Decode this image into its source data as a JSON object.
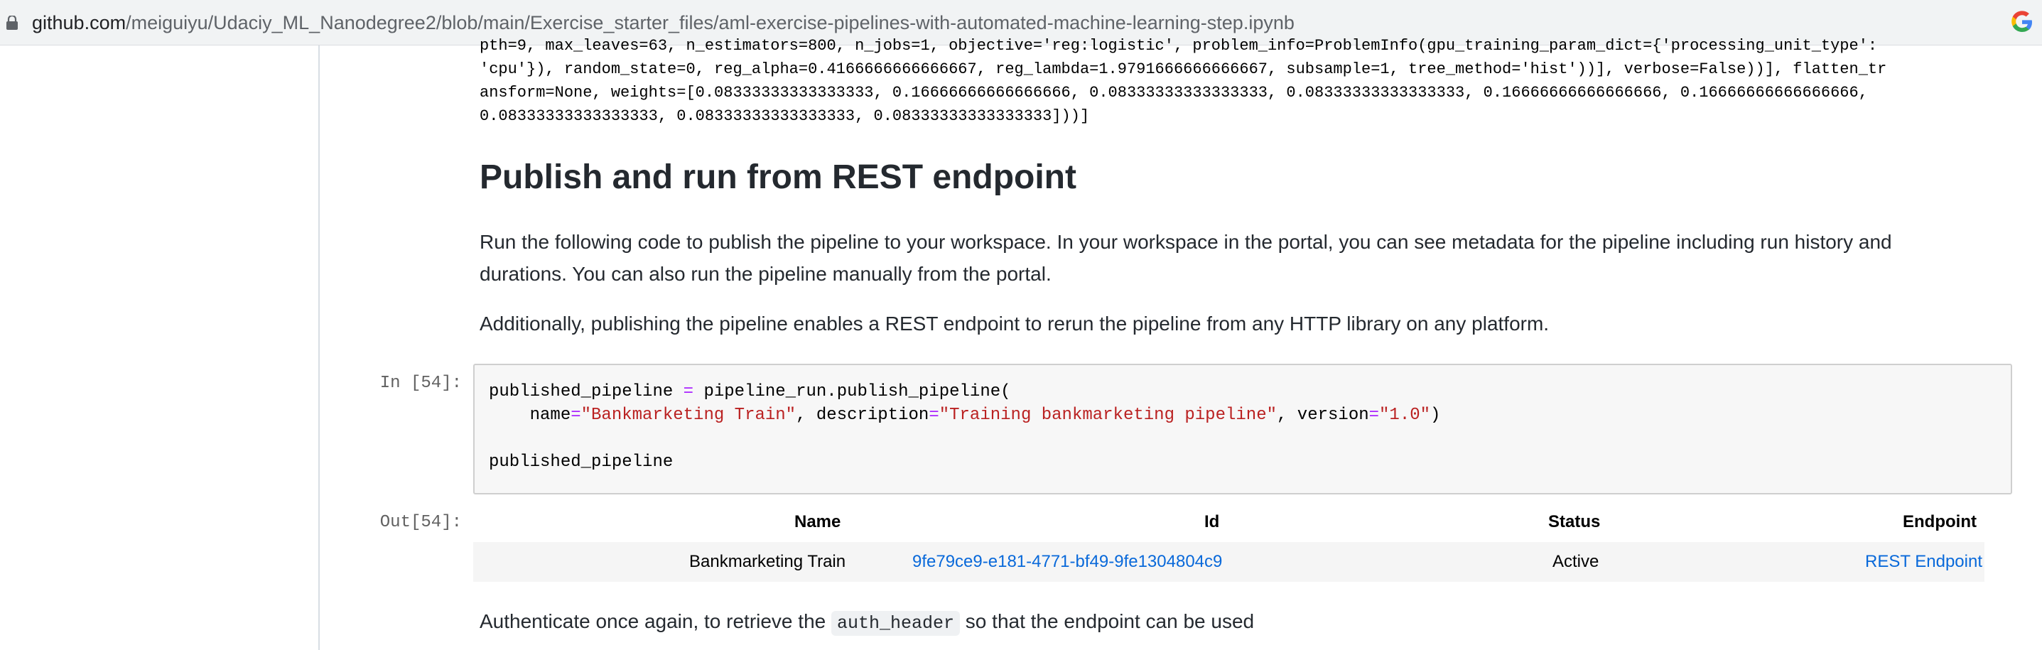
{
  "browser": {
    "url_domain": "github.com",
    "url_path": "/meiguiyu/Udaciy_ML_Nanodegree2/blob/main/Exercise_starter_files/aml-exercise-pipelines-with-automated-machine-learning-step.ipynb"
  },
  "code_overflow": {
    "line0": "pth=9, max_leaves=63, n_estimators=800, n_jobs=1, objective='reg:logistic', problem_info=ProblemInfo(gpu_training_param_dict={'processing_unit_type':",
    "line1": "'cpu'}), random_state=0, reg_alpha=0.4166666666666667, reg_lambda=1.9791666666666667, subsample=1, tree_method='hist'))], verbose=False))], flatten_tr",
    "line2": "ansform=None, weights=[0.08333333333333333, 0.16666666666666666, 0.08333333333333333, 0.08333333333333333, 0.16666666666666666, 0.16666666666666666,",
    "line3": "0.08333333333333333, 0.08333333333333333, 0.08333333333333333]))]"
  },
  "section": {
    "title": "Publish and run from REST endpoint",
    "para1_line1": "Run the following code to publish the pipeline to your workspace. In your workspace in the portal, you can see metadata for the pipeline including run history and",
    "para1_line2": "durations. You can also run the pipeline manually from the portal.",
    "para2": "Additionally, publishing the pipeline enables a REST endpoint to rerun the pipeline from any HTTP library on any platform."
  },
  "cell": {
    "in_prompt": "In [54]:",
    "out_prompt": "Out[54]:",
    "code": {
      "l1_a": "published_pipeline ",
      "l1_op": "=",
      "l1_b": " pipeline_run.publish_pipeline(",
      "l2_a": "    name",
      "l2_op1": "=",
      "l2_s1": "\"Bankmarketing Train\"",
      "l2_b": ", description",
      "l2_op2": "=",
      "l2_s2": "\"Training bankmarketing pipeline\"",
      "l2_c": ", version",
      "l2_op3": "=",
      "l2_s3": "\"1.0\"",
      "l2_d": ")",
      "l4": "published_pipeline"
    }
  },
  "output_table": {
    "headers": [
      "Name",
      "Id",
      "Status",
      "Endpoint"
    ],
    "row": {
      "name": "Bankmarketing Train",
      "id": "9fe79ce9-e181-4771-bf49-9fe1304804c9",
      "status": "Active",
      "endpoint": "REST Endpoint"
    }
  },
  "footer_text": {
    "before": "Authenticate once again, to retrieve the ",
    "code": "auth_header",
    "after": " so that the endpoint can be used"
  },
  "colors": {
    "link": "#0969da",
    "operator": "#aa22ff",
    "string": "#ba2121"
  }
}
